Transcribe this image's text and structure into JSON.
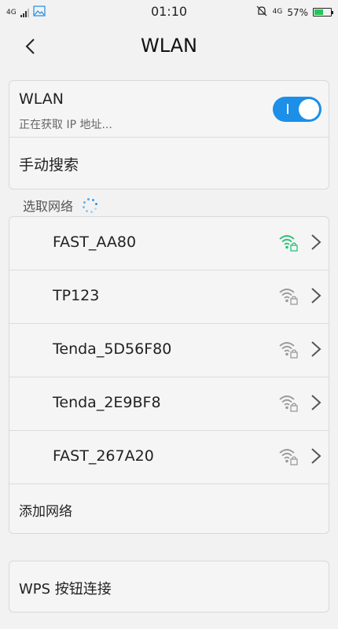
{
  "status_bar": {
    "network_type": "4G",
    "time": "01:10",
    "data_type": "4G",
    "battery_text": "57%",
    "battery_level": 0.57
  },
  "header": {
    "title": "WLAN"
  },
  "wlan": {
    "label": "WLAN",
    "status": "正在获取 IP 地址...",
    "enabled": true,
    "toggle_color": "#1c8fe8"
  },
  "manual_search": {
    "label": "手动搜索"
  },
  "networks_section": {
    "label": "选取网络"
  },
  "networks": [
    {
      "name": "FAST_AA80",
      "signal_icon": "wifi-lock-icon",
      "active_color": "#27c17a"
    },
    {
      "name": "TP123",
      "signal_icon": "wifi-lock-icon"
    },
    {
      "name": "Tenda_5D56F80",
      "signal_icon": "wifi-lock-icon"
    },
    {
      "name": "Tenda_2E9BF8",
      "signal_icon": "wifi-lock-icon"
    },
    {
      "name": "FAST_267A20",
      "signal_icon": "wifi-lock-icon"
    }
  ],
  "add_network": {
    "label": "添加网络"
  },
  "wps": {
    "label": "WPS 按钮连接"
  }
}
